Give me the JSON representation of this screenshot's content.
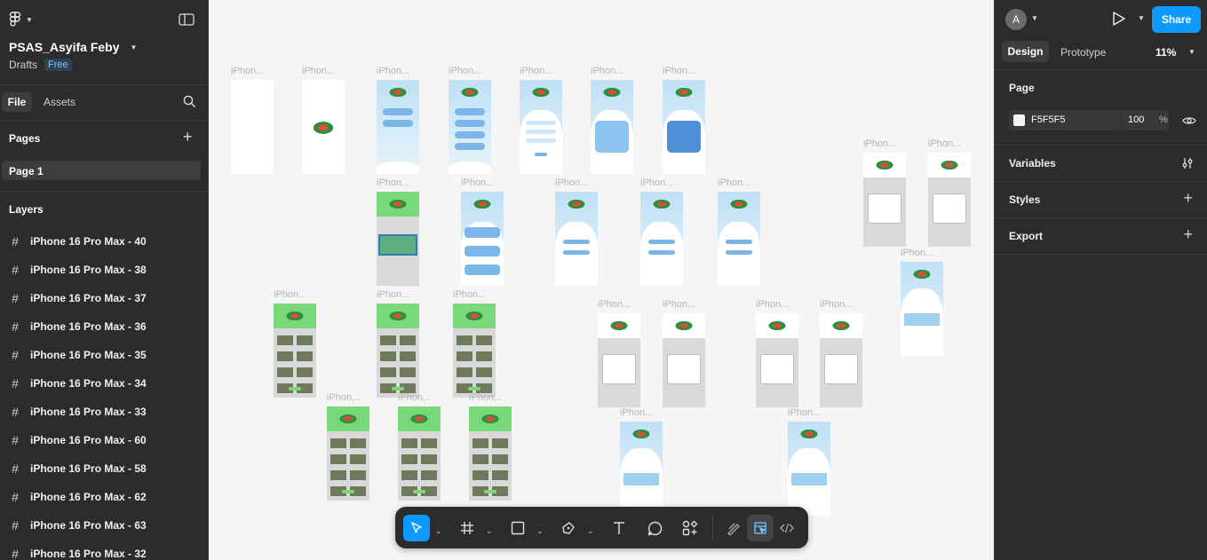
{
  "file": {
    "name": "PSAS_Asyifa Feby",
    "location": "Drafts",
    "plan_badge": "Free"
  },
  "left_tabs": {
    "file": "File",
    "assets": "Assets"
  },
  "pages": {
    "title": "Pages",
    "items": [
      "Page 1"
    ]
  },
  "layers": {
    "title": "Layers",
    "items": [
      "iPhone 16 Pro Max - 40",
      "iPhone 16 Pro Max - 38",
      "iPhone 16 Pro Max - 37",
      "iPhone 16 Pro Max - 36",
      "iPhone 16 Pro Max - 35",
      "iPhone 16 Pro Max - 34",
      "iPhone 16 Pro Max - 33",
      "iPhone 16 Pro Max - 60",
      "iPhone 16 Pro Max - 58",
      "iPhone 16 Pro Max - 62",
      "iPhone 16 Pro Max - 63",
      "iPhone 16 Pro Max - 32"
    ]
  },
  "header_right": {
    "avatar": "A",
    "share": "Share",
    "tab_design": "Design",
    "tab_prototype": "Prototype",
    "zoom": "11%"
  },
  "page_panel": {
    "title": "Page",
    "bg_hex": "F5F5F5",
    "opacity": "100",
    "percent": "%"
  },
  "sections": {
    "variables": "Variables",
    "styles": "Styles",
    "export": "Export"
  },
  "frame_label": "iPhon...",
  "help": "?",
  "colors": {
    "accent": "#0d99ff",
    "panel": "#2c2c2c",
    "canvas": "#f5f5f5",
    "header_green": "#79d97a",
    "button_blue": "#7ab6ea"
  }
}
